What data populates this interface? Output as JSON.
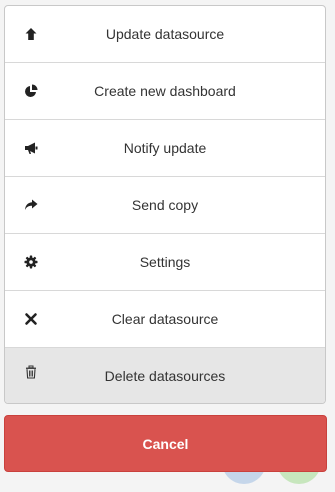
{
  "menu": {
    "items": [
      {
        "label": "Update datasource",
        "icon": "arrow-up-icon"
      },
      {
        "label": "Create new dashboard",
        "icon": "pie-chart-icon"
      },
      {
        "label": "Notify update",
        "icon": "megaphone-icon"
      },
      {
        "label": "Send copy",
        "icon": "share-arrow-icon"
      },
      {
        "label": "Settings",
        "icon": "gear-icon"
      },
      {
        "label": "Clear datasource",
        "icon": "close-icon"
      },
      {
        "label": "Delete datasources",
        "icon": "trash-icon"
      }
    ]
  },
  "cancel_label": "Cancel",
  "colors": {
    "cancel_bg": "#d9534f",
    "selected_bg": "#e6e6e6",
    "text": "#333333"
  }
}
